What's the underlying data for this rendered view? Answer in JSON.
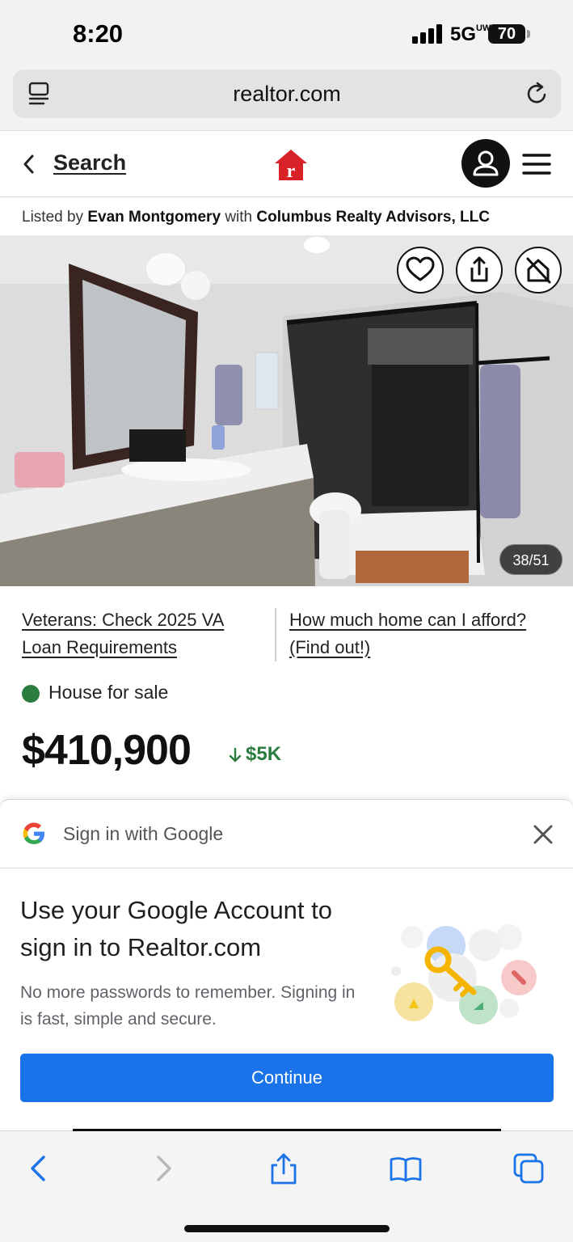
{
  "status_bar": {
    "time": "8:20",
    "network": "5G",
    "network_suffix": "UW",
    "battery": "70"
  },
  "browser": {
    "url": "realtor.com"
  },
  "header": {
    "back_label": "Search"
  },
  "listing": {
    "listed_prefix": "Listed by",
    "agent": "Evan Montgomery",
    "with_word": "with",
    "brokerage": "Columbus Realty Advisors, LLC",
    "photo_counter": "38/51",
    "promo_left": "Veterans: Check 2025 VA Loan Requirements",
    "promo_right": "How much home can I afford? (Find out!)",
    "status_label": "House for sale",
    "status_color": "#2a7d3e",
    "price": "$410,900",
    "price_change": "$5K"
  },
  "google_signin": {
    "header": "Sign in with Google",
    "title": "Use your Google Account to sign in to Realtor.com",
    "subtitle": "No more passwords to remember. Signing in is fast, simple and secure.",
    "button": "Continue",
    "button_color": "#1a73e8"
  },
  "toolbar": {
    "icons": [
      "back-icon",
      "forward-icon",
      "share-icon",
      "bookmarks-icon",
      "tabs-icon"
    ]
  }
}
